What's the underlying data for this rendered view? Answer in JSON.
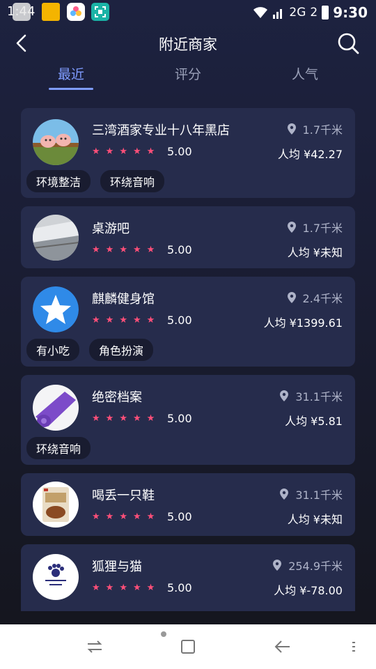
{
  "status_bar": {
    "time_left": "1:44",
    "signal": "2G",
    "battery": "2",
    "clock": "9:30"
  },
  "header": {
    "title": "附近商家"
  },
  "tabs": [
    {
      "label": "最近",
      "active": true
    },
    {
      "label": "评分",
      "active": false
    },
    {
      "label": "人气",
      "active": false
    }
  ],
  "colors": {
    "accent": "#7f9cff",
    "star": "#ff4f79",
    "card": "#262c4c",
    "tag_bg": "#191c30"
  },
  "merchants": [
    {
      "name": "三湾酒家专业十八年黑店",
      "rating": "5.00",
      "distance": "1.7千米",
      "avg": "人均 ¥42.27",
      "tags": [
        "环境整洁",
        "环绕音响"
      ],
      "avatar_icon": "pigs-photo"
    },
    {
      "name": "桌游吧",
      "rating": "5.00",
      "distance": "1.7千米",
      "avg": "人均 ¥未知",
      "tags": [],
      "avatar_icon": "room-photo"
    },
    {
      "name": "麒麟健身馆",
      "rating": "5.00",
      "distance": "2.4千米",
      "avg": "人均 ¥1399.61",
      "tags": [
        "有小吃",
        "角色扮演"
      ],
      "avatar_icon": "star-icon"
    },
    {
      "name": "绝密档案",
      "rating": "5.00",
      "distance": "31.1千米",
      "avg": "人均 ¥5.81",
      "tags": [
        "环绕音响"
      ],
      "avatar_icon": "yoga-mat-photo"
    },
    {
      "name": "喝丢一只鞋",
      "rating": "5.00",
      "distance": "31.1千米",
      "avg": "人均 ¥未知",
      "tags": [],
      "avatar_icon": "food-package-photo"
    },
    {
      "name": "狐狸与猫",
      "rating": "5.00",
      "distance": "254.9千米",
      "avg": "人均 ¥-78.00",
      "tags": [],
      "avatar_icon": "paw-logo"
    }
  ]
}
